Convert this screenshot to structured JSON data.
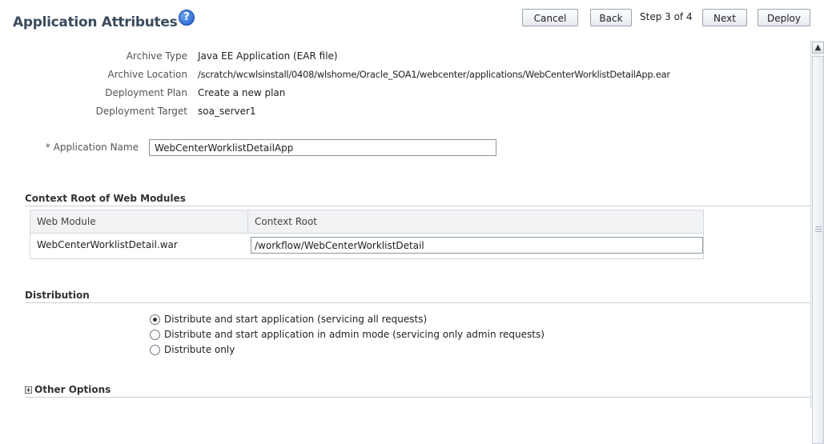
{
  "header": {
    "title": "Application Attributes",
    "help_glyph": "?",
    "cancel_label": "Cancel",
    "back_label": "Back",
    "step_text": "Step 3 of 4",
    "next_label": "Next",
    "deploy_label": "Deploy"
  },
  "summary": {
    "archive_type_label": "Archive Type",
    "archive_type_value": "Java EE Application (EAR file)",
    "archive_location_label": "Archive Location",
    "archive_location_value": "/scratch/wcwlsinstall/0408/wlshome/Oracle_SOA1/webcenter/applications/WebCenterWorklistDetailApp.ear",
    "deployment_plan_label": "Deployment Plan",
    "deployment_plan_value": "Create a new plan",
    "deployment_target_label": "Deployment Target",
    "deployment_target_value": "soa_server1"
  },
  "app_name": {
    "label": "* Application Name",
    "value": "WebCenterWorklistDetailApp"
  },
  "context_root": {
    "section_title": "Context Root of Web Modules",
    "columns": [
      "Web Module",
      "Context Root"
    ],
    "rows": [
      {
        "web_module": "WebCenterWorklistDetail.war",
        "context_root": "/workflow/WebCenterWorklistDetail"
      }
    ]
  },
  "distribution": {
    "section_title": "Distribution",
    "options": [
      {
        "label": "Distribute and start application (servicing all requests)",
        "selected": true
      },
      {
        "label": "Distribute and start application in admin mode (servicing only admin requests)",
        "selected": false
      },
      {
        "label": "Distribute only",
        "selected": false
      }
    ]
  },
  "other_options": {
    "label": "Other Options"
  }
}
